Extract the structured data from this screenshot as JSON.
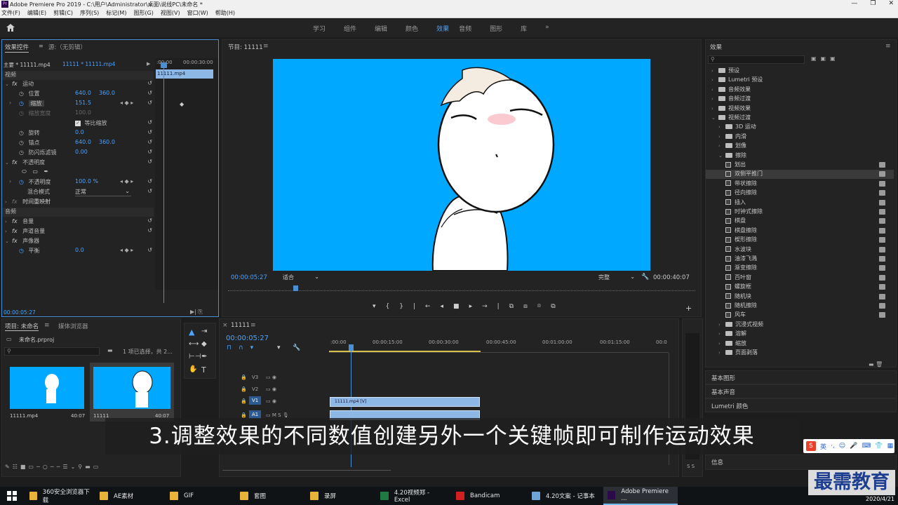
{
  "window": {
    "title": "Adobe Premiere Pro 2019 - C:\\用户\\Administrator\\桌面\\说线PC\\未命名 *",
    "app_logo": "Pr"
  },
  "menu": [
    "文件(F)",
    "编辑(E)",
    "剪辑(C)",
    "序列(S)",
    "标记(M)",
    "图形(G)",
    "视图(V)",
    "窗口(W)",
    "帮助(H)"
  ],
  "workspaces": {
    "tabs": [
      "学习",
      "组件",
      "编辑",
      "颜色",
      "效果",
      "音频",
      "图形",
      "库"
    ],
    "active": "效果",
    "more": "»"
  },
  "effect_controls": {
    "tab_label": "效果控件",
    "source_label": "源:（无剪辑）",
    "master": "主要 * 11111.mp4",
    "sequence_clip": "11111 * 11111.mp4",
    "time_start": ":00:00",
    "time_end": "00:00:30:00",
    "clip_label": "11111.mp4",
    "video_header": "视频",
    "audio_header": "音频",
    "rows": [
      {
        "fx": "fx",
        "label": "运动"
      },
      {
        "label": "位置",
        "v1": "640.0",
        "v2": "360.0"
      },
      {
        "label": "缩放",
        "v1": "151.5"
      },
      {
        "label": "缩放宽度",
        "v1": "100.0"
      },
      {
        "label": "等比缩放"
      },
      {
        "label": "旋转",
        "v1": "0.0"
      },
      {
        "label": "锚点",
        "v1": "640.0",
        "v2": "360.0"
      },
      {
        "label": "防闪烁滤镜",
        "v1": "0.00"
      },
      {
        "fx": "fx",
        "label": "不透明度"
      },
      {
        "label": "不透明度",
        "v1": "100.0 %"
      },
      {
        "label": "混合模式",
        "v1": "正常"
      },
      {
        "fx": "fx",
        "label": "时间重映射"
      },
      {
        "fx": "fx",
        "label": "音量"
      },
      {
        "fx": "fx",
        "label": "声道音量"
      },
      {
        "fx": "fx",
        "label": "声像器"
      },
      {
        "label": "平衡",
        "v1": "0.0"
      }
    ],
    "current_time": "00:00:05:27"
  },
  "program": {
    "title": "节目: 11111",
    "timecode": "00:00:05:27",
    "fit": "适合",
    "quality": "完整",
    "duration": "00:00:40:07"
  },
  "effects_panel": {
    "title": "效果",
    "items": [
      {
        "level": 0,
        "type": "folder",
        "label": "预设",
        "open": false
      },
      {
        "level": 0,
        "type": "folder",
        "label": "Lumetri 预设",
        "open": false
      },
      {
        "level": 0,
        "type": "folder",
        "label": "音频效果",
        "open": false
      },
      {
        "level": 0,
        "type": "folder",
        "label": "音频过渡",
        "open": false
      },
      {
        "level": 0,
        "type": "folder",
        "label": "视频效果",
        "open": false
      },
      {
        "level": 0,
        "type": "folder",
        "label": "视频过渡",
        "open": true
      },
      {
        "level": 1,
        "type": "folder",
        "label": "3D 运动",
        "open": false
      },
      {
        "level": 1,
        "type": "folder",
        "label": "内滑",
        "open": false
      },
      {
        "level": 1,
        "type": "folder",
        "label": "划像",
        "open": false
      },
      {
        "level": 1,
        "type": "folder",
        "label": "擦除",
        "open": true
      },
      {
        "level": 2,
        "type": "fx",
        "label": "划出"
      },
      {
        "level": 2,
        "type": "fx",
        "label": "双侧平推门",
        "selected": true
      },
      {
        "level": 2,
        "type": "fx",
        "label": "带状擦除"
      },
      {
        "level": 2,
        "type": "fx",
        "label": "径向擦除"
      },
      {
        "level": 2,
        "type": "fx",
        "label": "插入"
      },
      {
        "level": 2,
        "type": "fx",
        "label": "时钟式擦除"
      },
      {
        "level": 2,
        "type": "fx",
        "label": "棋盘"
      },
      {
        "level": 2,
        "type": "fx",
        "label": "棋盘擦除"
      },
      {
        "level": 2,
        "type": "fx",
        "label": "楔形擦除"
      },
      {
        "level": 2,
        "type": "fx",
        "label": "水波块"
      },
      {
        "level": 2,
        "type": "fx",
        "label": "油漆飞溅"
      },
      {
        "level": 2,
        "type": "fx",
        "label": "渐变擦除"
      },
      {
        "level": 2,
        "type": "fx",
        "label": "百叶窗"
      },
      {
        "level": 2,
        "type": "fx",
        "label": "螺旋框"
      },
      {
        "level": 2,
        "type": "fx",
        "label": "随机块"
      },
      {
        "level": 2,
        "type": "fx",
        "label": "随机擦除"
      },
      {
        "level": 2,
        "type": "fx",
        "label": "风车"
      },
      {
        "level": 1,
        "type": "folder",
        "label": "沉浸式视频",
        "open": false
      },
      {
        "level": 1,
        "type": "folder",
        "label": "溶解",
        "open": false
      },
      {
        "level": 1,
        "type": "folder",
        "label": "缩放",
        "open": false
      },
      {
        "level": 1,
        "type": "folder",
        "label": "页面剥落",
        "open": false
      }
    ],
    "sections": [
      "基本图形",
      "基本声音",
      "Lumetri 颜色"
    ],
    "info": "信息"
  },
  "project": {
    "tab_label": "项目: 未命名",
    "browser_tab": "媒体浏览器",
    "file": "未命名.prproj",
    "selection": "1 项已选择，共 2...",
    "items": [
      {
        "name": "11111.mp4",
        "duration": "40:07"
      },
      {
        "name": "11111",
        "duration": "40:07"
      }
    ]
  },
  "timeline": {
    "tab": "11111",
    "timecode": "00:00:05:27",
    "ruler": [
      ":00:00",
      "00:00:15:00",
      "00:00:30:00",
      "00:00:45:00",
      "00:01:00:00",
      "00:01:15:00",
      "00:0"
    ],
    "tracks": [
      "V3",
      "V2",
      "V1",
      "A1"
    ],
    "clip_label": "11111.mp4 [V]",
    "meter_label": "S S"
  },
  "subtitle": "3.调整效果的不同数值创建另外一个关键帧即可制作运动效果",
  "ime": {
    "label": "英"
  },
  "taskbar": {
    "items": [
      {
        "label": "360安全浏览器下载",
        "color": "#e8b339"
      },
      {
        "label": "AE素材",
        "color": "#e8b339"
      },
      {
        "label": "GIF",
        "color": "#e8b339"
      },
      {
        "label": "套图",
        "color": "#e8b339"
      },
      {
        "label": "录屏",
        "color": "#e8b339"
      },
      {
        "label": "4.20视频郑 - Excel",
        "color": "#1f7a44"
      },
      {
        "label": "Bandicam",
        "color": "#d02020"
      },
      {
        "label": "4.20文案 - 记事本",
        "color": "#6ea4d8"
      },
      {
        "label": "Adobe Premiere ...",
        "color": "#2a0a4a"
      }
    ],
    "date": "2020/4/21"
  },
  "watermark": "最需教育"
}
